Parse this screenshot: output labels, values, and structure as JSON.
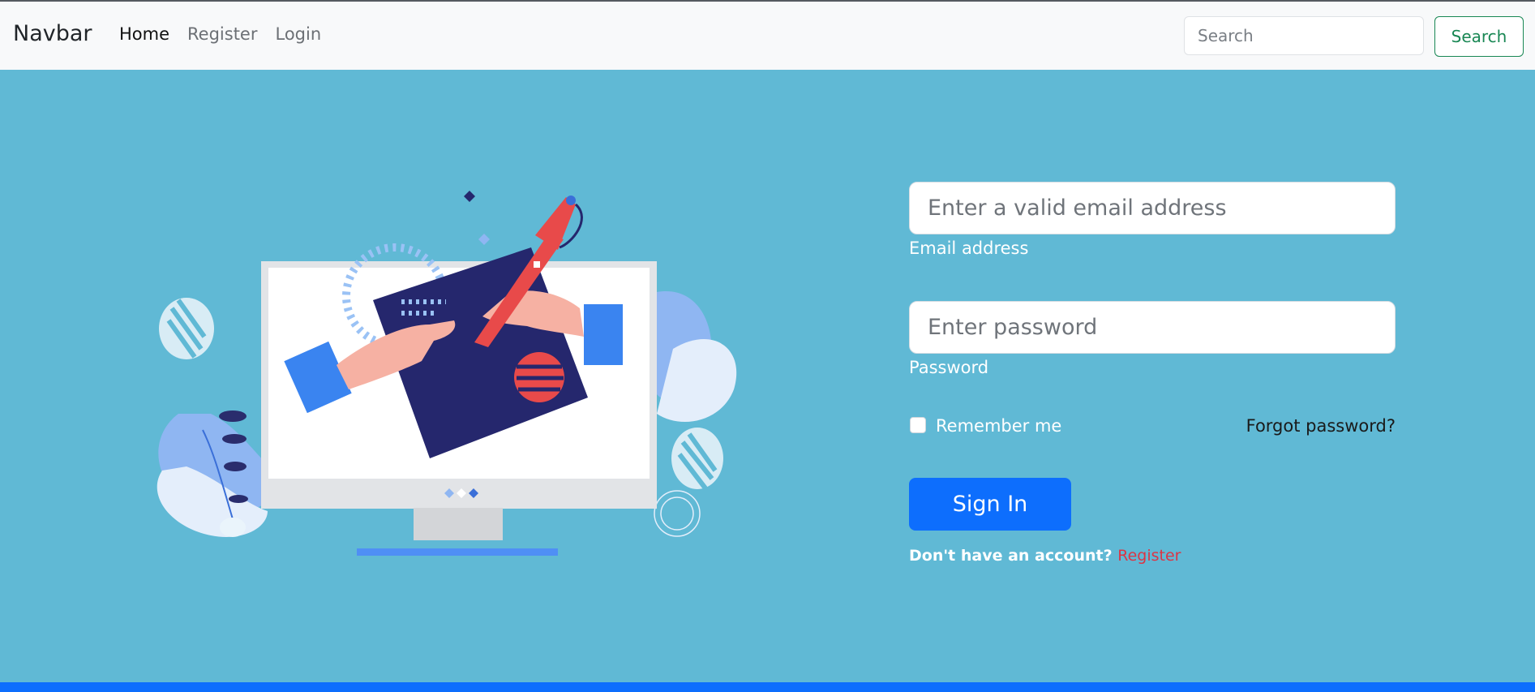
{
  "navbar": {
    "brand": "Navbar",
    "links": [
      {
        "label": "Home",
        "active": true
      },
      {
        "label": "Register",
        "active": false
      },
      {
        "label": "Login",
        "active": false
      }
    ],
    "search_placeholder": "Search",
    "search_button": "Search"
  },
  "colors": {
    "page_background": "#60b9d5",
    "navbar_background": "#f8f9fa",
    "primary": "#0d6efd",
    "search_button": "#198754",
    "register_link": "#dc3545"
  },
  "login_form": {
    "email_placeholder": "Enter a valid email address",
    "email_label": "Email address",
    "password_placeholder": "Enter password",
    "password_label": "Password",
    "remember_me": "Remember me",
    "remember_checked": false,
    "forgot_password": "Forgot password?",
    "sign_in": "Sign In",
    "no_account": "Don't have an account?",
    "register": "Register"
  },
  "illustration": {
    "icon": "computer-drawing-illustration"
  }
}
